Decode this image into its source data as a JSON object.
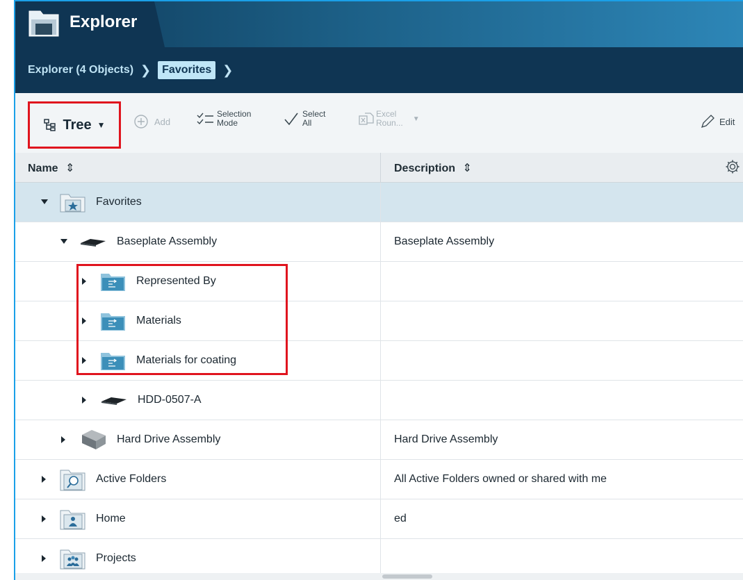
{
  "app": {
    "title": "Explorer"
  },
  "breadcrumb": {
    "root": "Explorer (4 Objects)",
    "current": "Favorites"
  },
  "toolbar": {
    "tree_label": "Tree",
    "add_label": "Add",
    "selection_mode_line1": "Selection",
    "selection_mode_line2": "Mode",
    "select_all_line1": "Select",
    "select_all_line2": "All",
    "excel_line1": "Excel",
    "excel_line2": "Roun...",
    "edit_label": "Edit"
  },
  "grid": {
    "columns": {
      "name": "Name",
      "description": "Description"
    },
    "rows": [
      {
        "name": "Favorites",
        "description": "",
        "expanded": true,
        "icon": "favorites-folder-icon"
      },
      {
        "name": "Baseplate Assembly",
        "description": "Baseplate Assembly",
        "expanded": true,
        "icon": "part-icon"
      },
      {
        "name": "Represented By",
        "description": "",
        "expanded": false,
        "icon": "relationship-folder-icon"
      },
      {
        "name": "Materials",
        "description": "",
        "expanded": false,
        "icon": "relationship-folder-icon"
      },
      {
        "name": "Materials for coating",
        "description": "",
        "expanded": false,
        "icon": "relationship-folder-icon"
      },
      {
        "name": "HDD-0507-A",
        "description": "",
        "expanded": false,
        "icon": "part-icon"
      },
      {
        "name": "Hard Drive Assembly",
        "description": "Hard Drive Assembly",
        "expanded": false,
        "icon": "hard-drive-icon"
      },
      {
        "name": "Active Folders",
        "description": "All Active Folders owned or shared with me",
        "expanded": false,
        "icon": "search-folder-icon"
      },
      {
        "name": "Home",
        "description": "ed",
        "expanded": false,
        "icon": "home-folder-icon"
      },
      {
        "name": "Projects",
        "description": "",
        "expanded": false,
        "icon": "projects-folder-icon"
      }
    ]
  }
}
